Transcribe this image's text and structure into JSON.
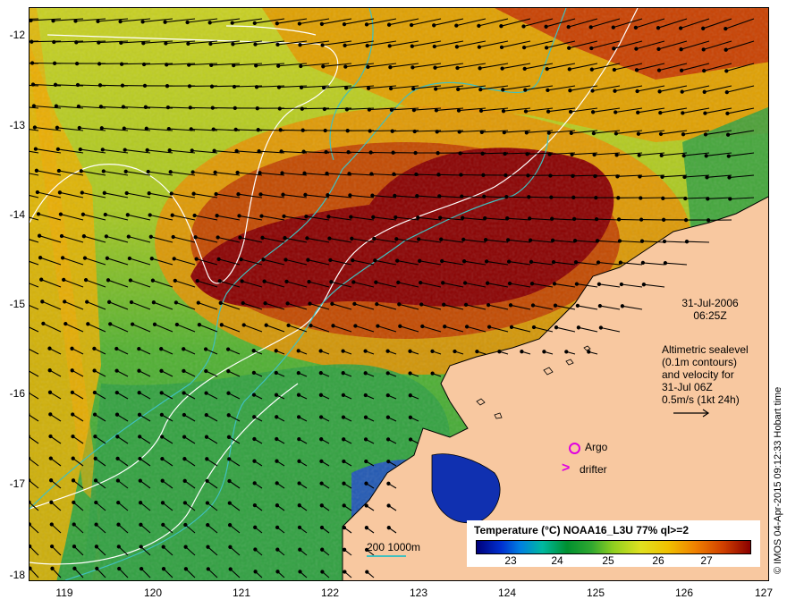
{
  "map": {
    "y_axis_labels": [
      "-12",
      "-13",
      "-14",
      "-15",
      "-16",
      "-17",
      "-18"
    ],
    "x_axis_labels": [
      "119",
      "120",
      "121",
      "122",
      "123",
      "124",
      "125",
      "126",
      "127"
    ],
    "lat_range": [
      -18,
      -11.8
    ],
    "lon_range": [
      118.6,
      127
    ]
  },
  "annotation": {
    "date": "31-Jul-2006",
    "time": "06:25Z",
    "legend_lines": [
      "Altimetric sealevel",
      "(0.1m contours)",
      "and velocity for",
      "31-Jul 06Z",
      "0.5m/s (1kt 24h)"
    ]
  },
  "markers": {
    "argo_label": "Argo",
    "drifter_label": "drifter",
    "marker_color": "#e000e0"
  },
  "colorbar": {
    "title": "Temperature (°C) NOAA16_L3U 77% ql>=2",
    "ticks": [
      "23",
      "24",
      "25",
      "26",
      "27"
    ]
  },
  "depth_legend": "200  1000m",
  "credit": "© IMOS 04-Apr-2015 09:12:33 Hobart time",
  "colors": {
    "land": "#f8c8a0",
    "warm": "#8a0000",
    "cool": "#00a040",
    "cold": "#0030b0",
    "contour": "#ffffff",
    "isobath": "#40c0c0"
  }
}
